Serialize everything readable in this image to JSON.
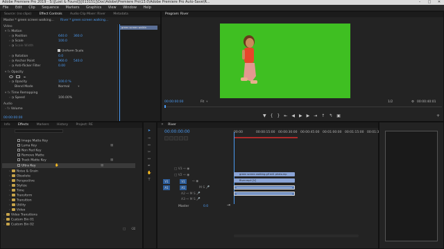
{
  "window": {
    "title": "Adobe Premiere Pro 2019 - S:\\[Lost & Found]\\[013151]\\Doc\\Adobe\\Premiere Pro\\13.0\\Adobe Premiere Pro Auto-Save\\R..."
  },
  "menu": [
    "File",
    "Edit",
    "Clip",
    "Sequence",
    "Markers",
    "Graphics",
    "View",
    "Window",
    "Help"
  ],
  "source_panel": {
    "tabs": [
      "Source: (no clips)",
      "Effect Controls",
      "Audio Clip Mixer: River",
      "Metadata"
    ],
    "header_left": "Master * green screen walking...",
    "header_right": "River * green screen walking...",
    "mini_clip_label": "green screen walkin",
    "sections": {
      "video": "Video",
      "motion": "Motion",
      "opacity": "Opacity",
      "time_remap": "Time Remapping",
      "audio": "Audio",
      "volume": "Volume"
    },
    "props": {
      "position": "Position",
      "position_x": "640.0",
      "position_y": "360.0",
      "scale": "Scale",
      "scale_val": "100.0",
      "scale_width": "Scale Width",
      "uniform_scale": "Uniform Scale",
      "rotation": "Rotation",
      "rotation_val": "0.0",
      "anchor": "Anchor Point",
      "anchor_x": "960.0",
      "anchor_y": "540.0",
      "antiflicker": "Anti-flicker Filter",
      "antiflicker_val": "0.00",
      "opacity": "Opacity",
      "opacity_val": "100.0 %",
      "blend": "Blend Mode",
      "blend_val": "Normal",
      "speed": "Speed",
      "speed_val": "100.00%"
    }
  },
  "program_monitor": {
    "tab": "Program: River",
    "timecode_left": "00:00:00:00",
    "fit": "Fit",
    "page": "1/2",
    "timecode_right": "00:00:40:01"
  },
  "effects_panel": {
    "tabs": [
      "Info",
      "Effects",
      "Markers",
      "History",
      "Project: RE"
    ],
    "items": [
      "Image Matte Key",
      "Luma Key",
      "Non Red Key",
      "Remove Matte",
      "Track Matte Key",
      "Ultra Key"
    ],
    "folders": [
      "Noise & Grain",
      "Obsolete",
      "Perspective",
      "Stylize",
      "Time",
      "Transform",
      "Transition",
      "Utility",
      "Video"
    ],
    "bottom_folders": [
      "Video Transitions",
      "Custom Bin 01",
      "Custom Bin 02"
    ]
  },
  "timeline": {
    "tab": "River",
    "timecode": "00:00:00:00",
    "ruler": [
      "00:00",
      "00:00:15:00",
      "00:00:30:00",
      "00:00:45:00",
      "00:01:00:00",
      "00:01:15:00",
      "00:01:30:00"
    ],
    "tracks": [
      {
        "id": "V3",
        "src": ""
      },
      {
        "id": "V2",
        "src": ""
      },
      {
        "id": "V1",
        "src": "V1"
      },
      {
        "id": "A1",
        "src": "A1"
      },
      {
        "id": "A2",
        "src": ""
      },
      {
        "id": "A3",
        "src": ""
      }
    ],
    "master": "Master",
    "master_val": "0.0",
    "clips": {
      "v2": "green screen walking.gif ed1 photo.mp",
      "v1": "River.mp4 [V]",
      "a1": "",
      "a2": ""
    }
  },
  "colors": {
    "green_screen": "#3fbf22",
    "accent": "#4b9cf5",
    "clip_video": "#8aa4d6",
    "clip_audio": "#5f7fb5"
  }
}
